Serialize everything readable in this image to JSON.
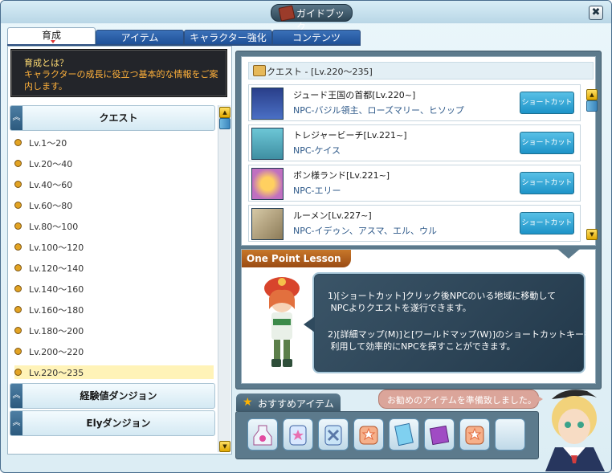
{
  "window": {
    "title": "ガイドブック",
    "close_label": "✖"
  },
  "tabs": [
    {
      "label": "育成",
      "active": true
    },
    {
      "label": "アイテム",
      "active": false
    },
    {
      "label": "キャラクター強化",
      "active": false
    },
    {
      "label": "コンテンツ",
      "active": false
    }
  ],
  "intro": {
    "title": "育成とは？",
    "description": "キャラクターの成長に役立つ基本的な情報をご案内します。"
  },
  "categories": [
    {
      "label": "クエスト",
      "expanded": true
    },
    {
      "label": "経験値ダンジョン",
      "expanded": false
    },
    {
      "label": "Elyダンジョン",
      "expanded": false
    }
  ],
  "level_items": [
    {
      "label": "Lv.1～20"
    },
    {
      "label": "Lv.20～40"
    },
    {
      "label": "Lv.40～60"
    },
    {
      "label": "Lv.60～80"
    },
    {
      "label": "Lv.80～100"
    },
    {
      "label": "Lv.100～120"
    },
    {
      "label": "Lv.120～140"
    },
    {
      "label": "Lv.140～160"
    },
    {
      "label": "Lv.160～180"
    },
    {
      "label": "Lv.180～200"
    },
    {
      "label": "Lv.200～220"
    },
    {
      "label": "Lv.220～235",
      "selected": true
    }
  ],
  "quest": {
    "header": "クエスト - [Lv.220～235]",
    "items": [
      {
        "name": "ジュード王国の首都[Lv.220~]",
        "npc": "NPC-バジル領主、ローズマリー、ヒソップ",
        "button": "ショートカット"
      },
      {
        "name": "トレジャービーチ[Lv.221~]",
        "npc": "NPC-ケイス",
        "button": "ショートカット"
      },
      {
        "name": "ボン様ランド[Lv.221~]",
        "npc": "NPC-エリー",
        "button": "ショートカット"
      },
      {
        "name": "ルーメン[Lv.227~]",
        "npc": "NPC-イデゥン、アスマ、エル、ウル",
        "button": "ショートカット"
      }
    ]
  },
  "lesson": {
    "title": "One Point Lesson",
    "line1": "1)[ショートカット]クリック後NPCのいる地域に移動して\n NPCよりクエストを遂行できます。",
    "line2": "2)[詳細マップ(M)]と[ワールドマップ(W)]のショートカットキーを\n 利用して効率的にNPCを探すことができます。"
  },
  "recommend": {
    "title": "おすすめアイテム",
    "bubble": "お勧めのアイテムを準備致しました。",
    "items": [
      {
        "icon": "potion-bottle-icon"
      },
      {
        "icon": "star-jar-icon"
      },
      {
        "icon": "cross-jar-icon"
      },
      {
        "icon": "star-pouch-icon"
      },
      {
        "icon": "blue-card-icon"
      },
      {
        "icon": "purple-box-icon"
      },
      {
        "icon": "star-pouch-icon"
      },
      {
        "icon": "empty-slot"
      }
    ]
  },
  "colors": {
    "tab_active": "#ffffff",
    "tab_inactive": "#1d4f96",
    "shortcut_button": "#1d93c8",
    "lesson_header": "#b0601f",
    "intro_text": "#ffb13b"
  }
}
